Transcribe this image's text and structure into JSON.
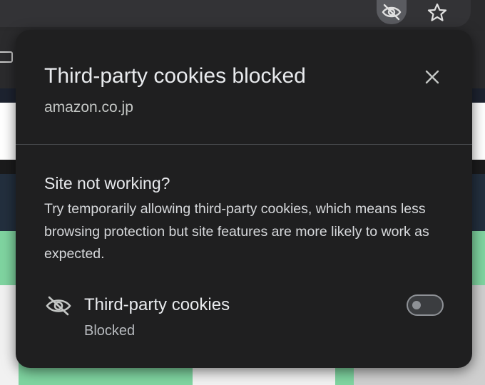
{
  "popup": {
    "title": "Third-party cookies blocked",
    "site": "amazon.co.jp",
    "close_icon": "close-icon",
    "section": {
      "heading": "Site not working?",
      "body": "Try temporarily allowing third-party cookies, which means less browsing protection but site features are more likely to work as expected."
    },
    "cookie_row": {
      "icon": "eye-slash-icon",
      "label": "Third-party cookies",
      "status": "Blocked",
      "toggle_on": false
    }
  },
  "toolbar": {
    "icons": [
      "eye-slash-icon",
      "star-icon"
    ]
  },
  "colors": {
    "bubble_bg": "#1f1f20",
    "text_primary": "#e8eaed",
    "text_secondary": "#c4c7c5",
    "toggle_off": "#8e9196"
  }
}
